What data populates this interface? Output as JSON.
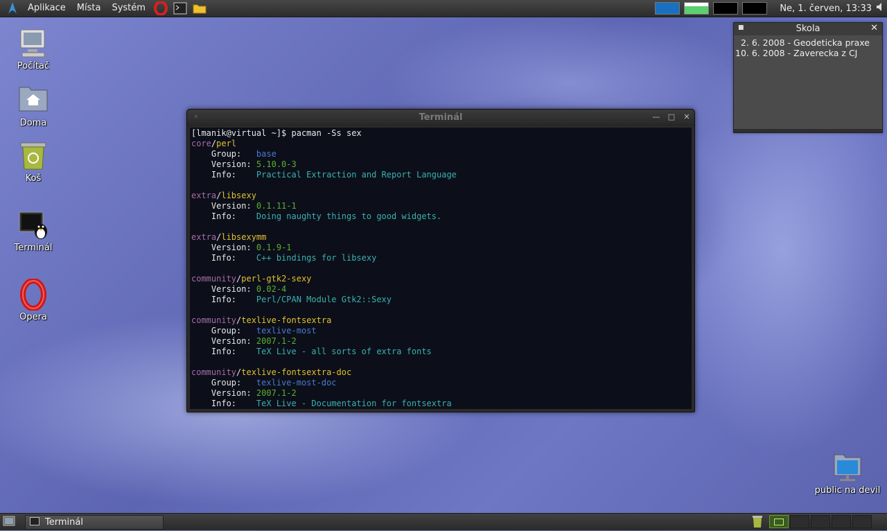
{
  "top_panel": {
    "menu": [
      "Aplikace",
      "Místa",
      "Systém"
    ],
    "launchers": [
      "opera-icon",
      "terminal-icon",
      "folder-icon"
    ],
    "clock": "Ne,  1. červen, 13:33"
  },
  "desktop_icons": [
    {
      "label": "Počítač",
      "icon": "computer-icon"
    },
    {
      "label": "Doma",
      "icon": "home-folder-icon"
    },
    {
      "label": "Koš",
      "icon": "trash-icon"
    },
    {
      "label": "Terminál",
      "icon": "terminal-icon"
    },
    {
      "label": "Opera",
      "icon": "opera-icon"
    },
    {
      "label": "public na devil",
      "icon": "network-folder-icon"
    }
  ],
  "terminal": {
    "title": "Terminál",
    "prompt": "[lmanik@virtual ~]$ pacman -Ss sex",
    "packages": [
      {
        "repo": "core",
        "name": "perl",
        "group": "base",
        "version": "5.10.0-3",
        "info": "Practical Extraction and Report Language"
      },
      {
        "repo": "extra",
        "name": "libsexy",
        "version": "0.1.11-1",
        "info": "Doing naughty things to good widgets."
      },
      {
        "repo": "extra",
        "name": "libsexymm",
        "version": "0.1.9-1",
        "info": "C++ bindings for libsexy"
      },
      {
        "repo": "community",
        "name": "perl-gtk2-sexy",
        "version": "0.02-4",
        "info": "Perl/CPAN Module Gtk2::Sexy"
      },
      {
        "repo": "community",
        "name": "texlive-fontsextra",
        "group": "texlive-most",
        "version": "2007.1-2",
        "info": "TeX Live - all sorts of extra fonts"
      },
      {
        "repo": "community",
        "name": "texlive-fontsextra-doc",
        "group": "texlive-most-doc",
        "version": "2007.1-2",
        "info": "TeX Live - Documentation for fontsextra"
      }
    ],
    "labels": {
      "group": "Group:",
      "version": "Version:",
      "info": "Info:"
    }
  },
  "skola": {
    "title": "Skola",
    "lines": [
      "  2. 6. 2008 - Geodeticka praxe",
      "10. 6. 2008 - Zaverecka z CJ"
    ]
  },
  "bottom_panel": {
    "task": "Terminál"
  },
  "colors": {
    "repo": "#a86ba8",
    "package": "#e4c030",
    "group": "#4a7ad0",
    "version": "#5cb030",
    "info": "#3ab0b0"
  }
}
